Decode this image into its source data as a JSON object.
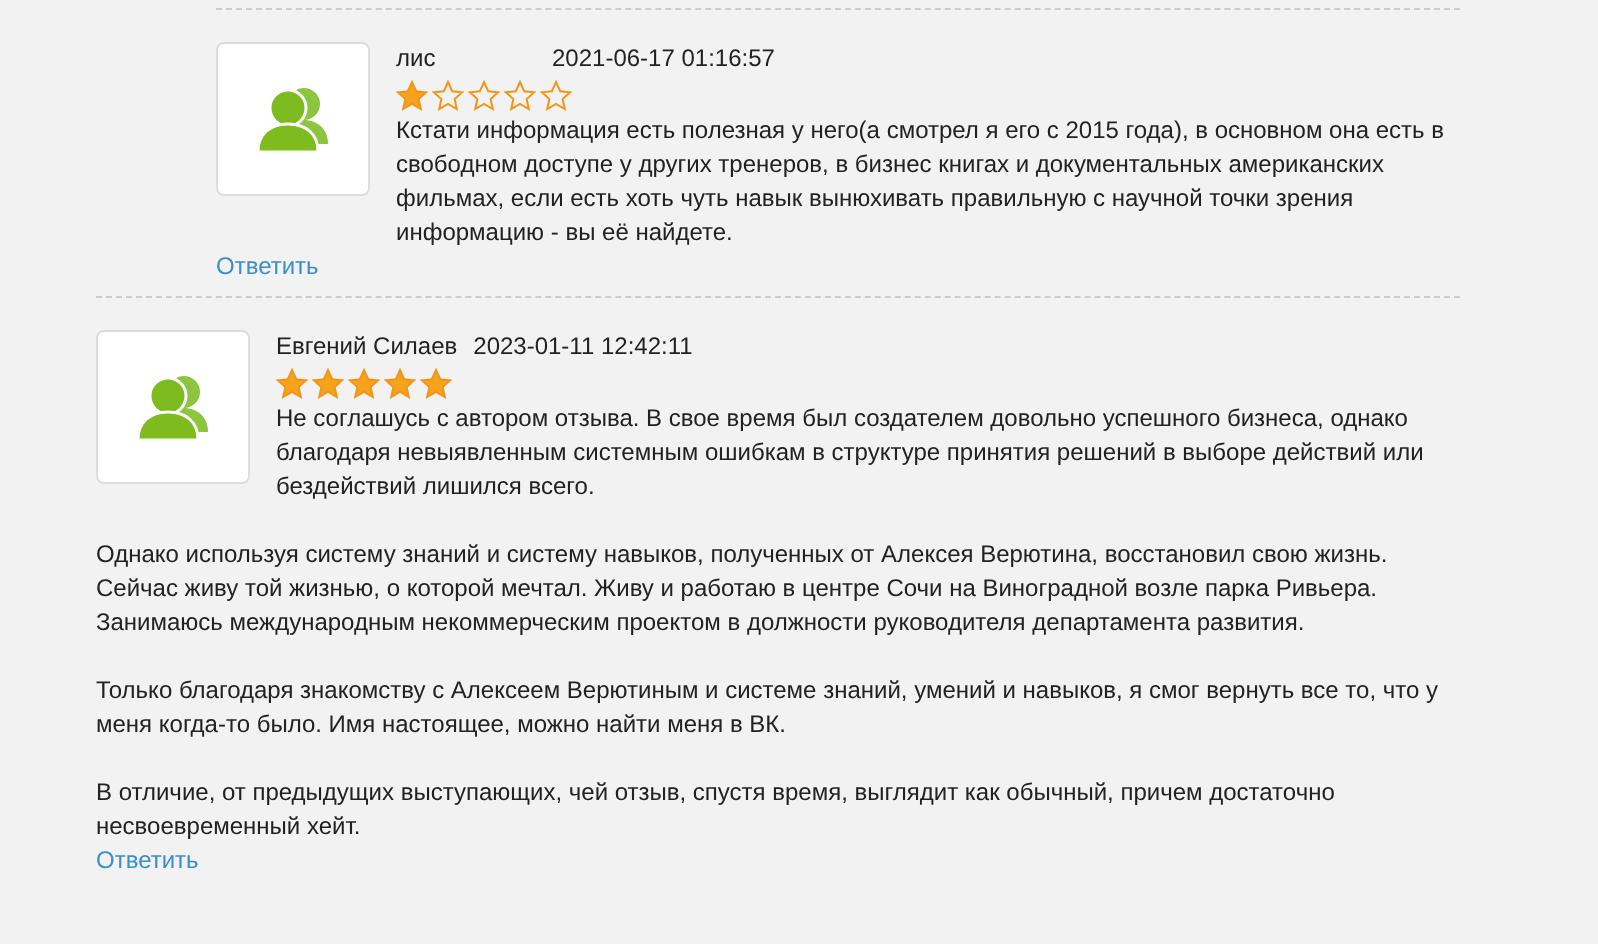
{
  "comments": [
    {
      "author": "лис",
      "date": "2021-06-17 01:16:57",
      "stars": 1,
      "indented": true,
      "paragraphs": [
        "Кстати информация есть полезная у него(а смотрел я его с 2015 года), в основном она есть в свободном доступе у других тренеров, в бизнес книгах и документальных американских фильмах, если есть хоть чуть навык вынюхивать правильную с научной точки зрения информацию - вы её найдете."
      ],
      "reply": "Ответить"
    },
    {
      "author": "Евгений Силаев",
      "date": "2023-01-11 12:42:11",
      "stars": 5,
      "indented": false,
      "paragraphs": [
        "Не соглашусь с автором отзыва. В свое время был создателем довольно успешного бизнеса, однако благодаря невыявленным системным ошибкам в структуре принятия решений в выборе действий или бездействий лишился всего.",
        "Однако используя систему знаний и систему навыков, полученных от Алексея Верютина, восстановил свою жизнь. Сейчас живу той жизнью, о которой мечтал. Живу и работаю в центре Сочи на Виноградной возле парка Ривьера. Занимаюсь международным некоммерческим проектом в должности руководителя департамента развития.",
        "Только благодаря знакомству с Алексеем Верютиным и системе знаний, умений и навыков, я смог вернуть все то, что у меня когда-то было. Имя настоящее, можно найти меня в ВК.",
        "В отличие, от предыдущих выступающих, чей отзыв, спустя время, выглядит как обычный, причем достаточно несвоевременный хейт."
      ],
      "reply": "Ответить"
    }
  ]
}
